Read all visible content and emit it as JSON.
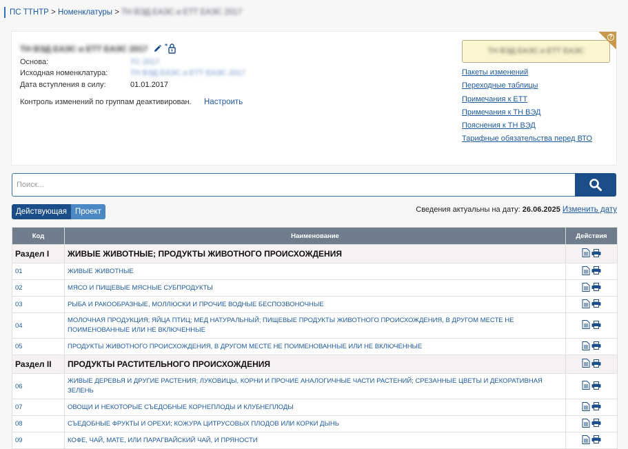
{
  "breadcrumb": {
    "root": "ПС ТТНТР",
    "sep1": ">",
    "level2": "Номенклатуры",
    "sep2": ">",
    "current": "ТН ВЭД ЕАЭС и ЕТТ ЕАЭС 2017"
  },
  "document": {
    "title": "ТН ВЭД ЕАЭС и ЕТТ ЕАЭС 2017",
    "fields": [
      {
        "label": "Основа:",
        "value": "ТС 2017"
      },
      {
        "label": "Исходная номенклатура:",
        "value": "ТН ВЭД ЕАЭС и ЕТТ ЕАЭС 2017"
      },
      {
        "label": "Дата вступления в силу:",
        "value": "01.01.2017"
      }
    ],
    "control_text": "Контроль изменений по группам деактивирован.",
    "control_link": "Настроить",
    "status": "ТН ВЭД ЕАЭС и ЕТТ ЕАЭС"
  },
  "side_links": [
    "Пакеты изменений",
    "Переходные таблицы",
    "Примечания к ЕТТ",
    "Примечания к ТН ВЭД",
    "Пояснения к ТН ВЭД",
    "Тарифные обязательства перед ВТО"
  ],
  "search": {
    "placeholder": "Поиск..."
  },
  "toggle": {
    "active": "Действующая",
    "inactive": "Проект"
  },
  "actual": {
    "label": "Сведения актуальны на дату:",
    "date": "26.06.2025",
    "change_link": "Изменить дату"
  },
  "table": {
    "headers": {
      "code": "Код",
      "name": "Наименование",
      "actions": "Действия"
    },
    "rows": [
      {
        "type": "section",
        "code": "Раздел I",
        "name": "ЖИВЫЕ ЖИВОТНЫЕ; ПРОДУКТЫ ЖИВОТНОГО ПРОИСХОЖДЕНИЯ"
      },
      {
        "type": "item",
        "code": "01",
        "name": "ЖИВЫЕ ЖИВОТНЫЕ"
      },
      {
        "type": "item",
        "code": "02",
        "name": "МЯСО И ПИЩЕВЫЕ МЯСНЫЕ СУБПРОДУКТЫ"
      },
      {
        "type": "item",
        "code": "03",
        "name": "РЫБА И РАКООБРАЗНЫЕ, МОЛЛЮСКИ И ПРОЧИЕ ВОДНЫЕ БЕСПОЗВОНОЧНЫЕ"
      },
      {
        "type": "item",
        "code": "04",
        "name": "МОЛОЧНАЯ ПРОДУКЦИЯ; ЯЙЦА ПТИЦ; МЕД НАТУРАЛЬНЫЙ; ПИЩЕВЫЕ ПРОДУКТЫ ЖИВОТНОГО ПРОИСХОЖДЕНИЯ, В ДРУГОМ МЕСТЕ НЕ ПОИМЕНОВАННЫЕ ИЛИ НЕ ВКЛЮЧЕННЫЕ"
      },
      {
        "type": "item",
        "code": "05",
        "name": "ПРОДУКТЫ ЖИВОТНОГО ПРОИСХОЖДЕНИЯ, В ДРУГОМ МЕСТЕ НЕ ПОИМЕНОВАННЫЕ ИЛИ НЕ ВКЛЮЧЕННЫЕ"
      },
      {
        "type": "section",
        "code": "Раздел II",
        "name": "ПРОДУКТЫ РАСТИТЕЛЬНОГО ПРОИСХОЖДЕНИЯ"
      },
      {
        "type": "item",
        "code": "06",
        "name": "ЖИВЫЕ ДЕРЕВЬЯ И ДРУГИЕ РАСТЕНИЯ; ЛУКОВИЦЫ, КОРНИ И ПРОЧИЕ АНАЛОГИЧНЫЕ ЧАСТИ РАСТЕНИЙ; СРЕЗАННЫЕ ЦВЕТЫ И ДЕКОРАТИВНАЯ ЗЕЛЕНЬ"
      },
      {
        "type": "item",
        "code": "07",
        "name": "ОВОЩИ И НЕКОТОРЫЕ СЪЕДОБНЫЕ КОРНЕПЛОДЫ И КЛУБНЕПЛОДЫ"
      },
      {
        "type": "item",
        "code": "08",
        "name": "СЪЕДОБНЫЕ ФРУКТЫ И ОРЕХИ; КОЖУРА ЦИТРУСОВЫХ ПЛОДОВ ИЛИ КОРКИ ДЫНЬ"
      },
      {
        "type": "item",
        "code": "09",
        "name": "КОФЕ, ЧАЙ, МАТЕ, ИЛИ ПАРАГВАЙСКИЙ ЧАЙ, И ПРЯНОСТИ"
      }
    ]
  },
  "icons": [
    "pencil-icon",
    "lock-icon",
    "document-icon",
    "printer-icon",
    "search-icon",
    "help-icon"
  ],
  "colors": {
    "accent": "#1b4d89",
    "link": "#1d5aa0",
    "header": "#6e7c8c",
    "section_bg": "#f6f1f3",
    "status_bg": "#fbf6cf"
  }
}
